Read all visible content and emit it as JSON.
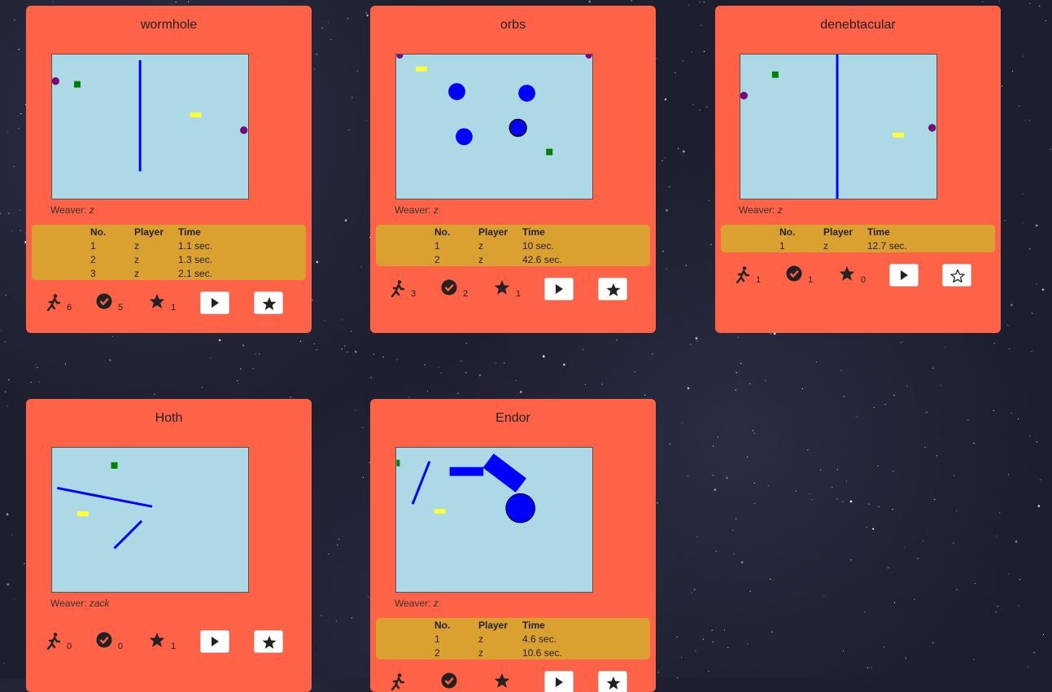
{
  "weaver_label": "Weaver:",
  "score_headers": {
    "no": "No.",
    "player": "Player",
    "time": "Time"
  },
  "colors": {
    "card": "#ff6347",
    "canvas": "#add8e6",
    "scores": "#daa030"
  },
  "puzzles": [
    {
      "title": "wormhole",
      "weaver": "z",
      "scores": [
        {
          "no": "1",
          "player": "z",
          "time": "1.1 sec."
        },
        {
          "no": "2",
          "player": "z",
          "time": "1.3 sec."
        },
        {
          "no": "3",
          "player": "z",
          "time": "2.1 sec."
        }
      ],
      "plays": "6",
      "solves": "5",
      "stars": "1",
      "starred": true
    },
    {
      "title": "orbs",
      "weaver": "z",
      "scores": [
        {
          "no": "1",
          "player": "z",
          "time": "10 sec."
        },
        {
          "no": "2",
          "player": "z",
          "time": "42.6 sec."
        }
      ],
      "plays": "3",
      "solves": "2",
      "stars": "1",
      "starred": true
    },
    {
      "title": "denebtacular",
      "weaver": "z",
      "scores": [
        {
          "no": "1",
          "player": "z",
          "time": "12.7 sec."
        }
      ],
      "plays": "1",
      "solves": "1",
      "stars": "0",
      "starred": false
    },
    {
      "title": "Hoth",
      "weaver": "zack",
      "scores": [],
      "plays": "0",
      "solves": "0",
      "stars": "1",
      "starred": true
    },
    {
      "title": "Endor",
      "weaver": "z",
      "scores": [
        {
          "no": "1",
          "player": "z",
          "time": "4.6 sec."
        },
        {
          "no": "2",
          "player": "z",
          "time": "10.6 sec."
        }
      ],
      "plays": "",
      "solves": "",
      "stars": "",
      "starred": true
    }
  ]
}
